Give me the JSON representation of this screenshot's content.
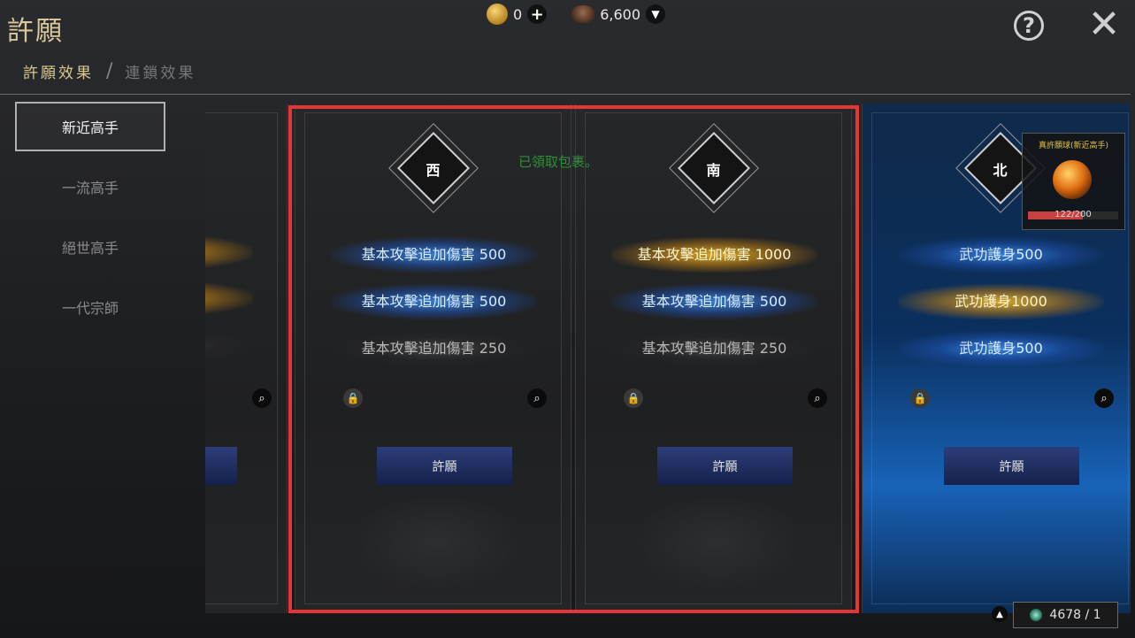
{
  "title": "許願",
  "subnav": {
    "active": "許願效果",
    "separator": "/",
    "inactive": "連鎖效果"
  },
  "currency": {
    "coin_value": "0",
    "ore_value": "6,600",
    "coin_icon": "gold-coin-icon",
    "ore_icon": "ore-icon"
  },
  "sidebar": {
    "items": [
      {
        "label": "新近高手"
      },
      {
        "label": "一流高手"
      },
      {
        "label": "絕世高手"
      },
      {
        "label": "一代宗師"
      }
    ]
  },
  "notice": "已領取包裹。",
  "cards": [
    {
      "direction": "",
      "effects": [],
      "wish": "許願"
    },
    {
      "direction": "西",
      "effects": [
        {
          "text": "基本攻擊追加傷害 500",
          "tone": "blue"
        },
        {
          "text": "基本攻擊追加傷害 500",
          "tone": "blue"
        },
        {
          "text": "基本攻擊追加傷害 250",
          "tone": "dim"
        }
      ],
      "wish": "許願"
    },
    {
      "direction": "南",
      "effects": [
        {
          "text": "基本攻擊追加傷害 1000",
          "tone": "gold"
        },
        {
          "text": "基本攻擊追加傷害 500",
          "tone": "blue"
        },
        {
          "text": "基本攻擊追加傷害 250",
          "tone": "dim"
        }
      ],
      "wish": "許願"
    },
    {
      "direction": "北",
      "effects": [
        {
          "text": "武功護身500",
          "tone": "blue"
        },
        {
          "text": "武功護身1000",
          "tone": "gold"
        },
        {
          "text": "武功護身500",
          "tone": "blue"
        }
      ],
      "wish": "許願"
    }
  ],
  "reward": {
    "title": "真許願球(新近高手)",
    "progress_text": "122/200",
    "progress_fraction": 0.61
  },
  "footer": {
    "value": "4678 / 1"
  },
  "colors": {
    "highlight_border": "#e63535",
    "gold_text": "#d8c89a"
  }
}
